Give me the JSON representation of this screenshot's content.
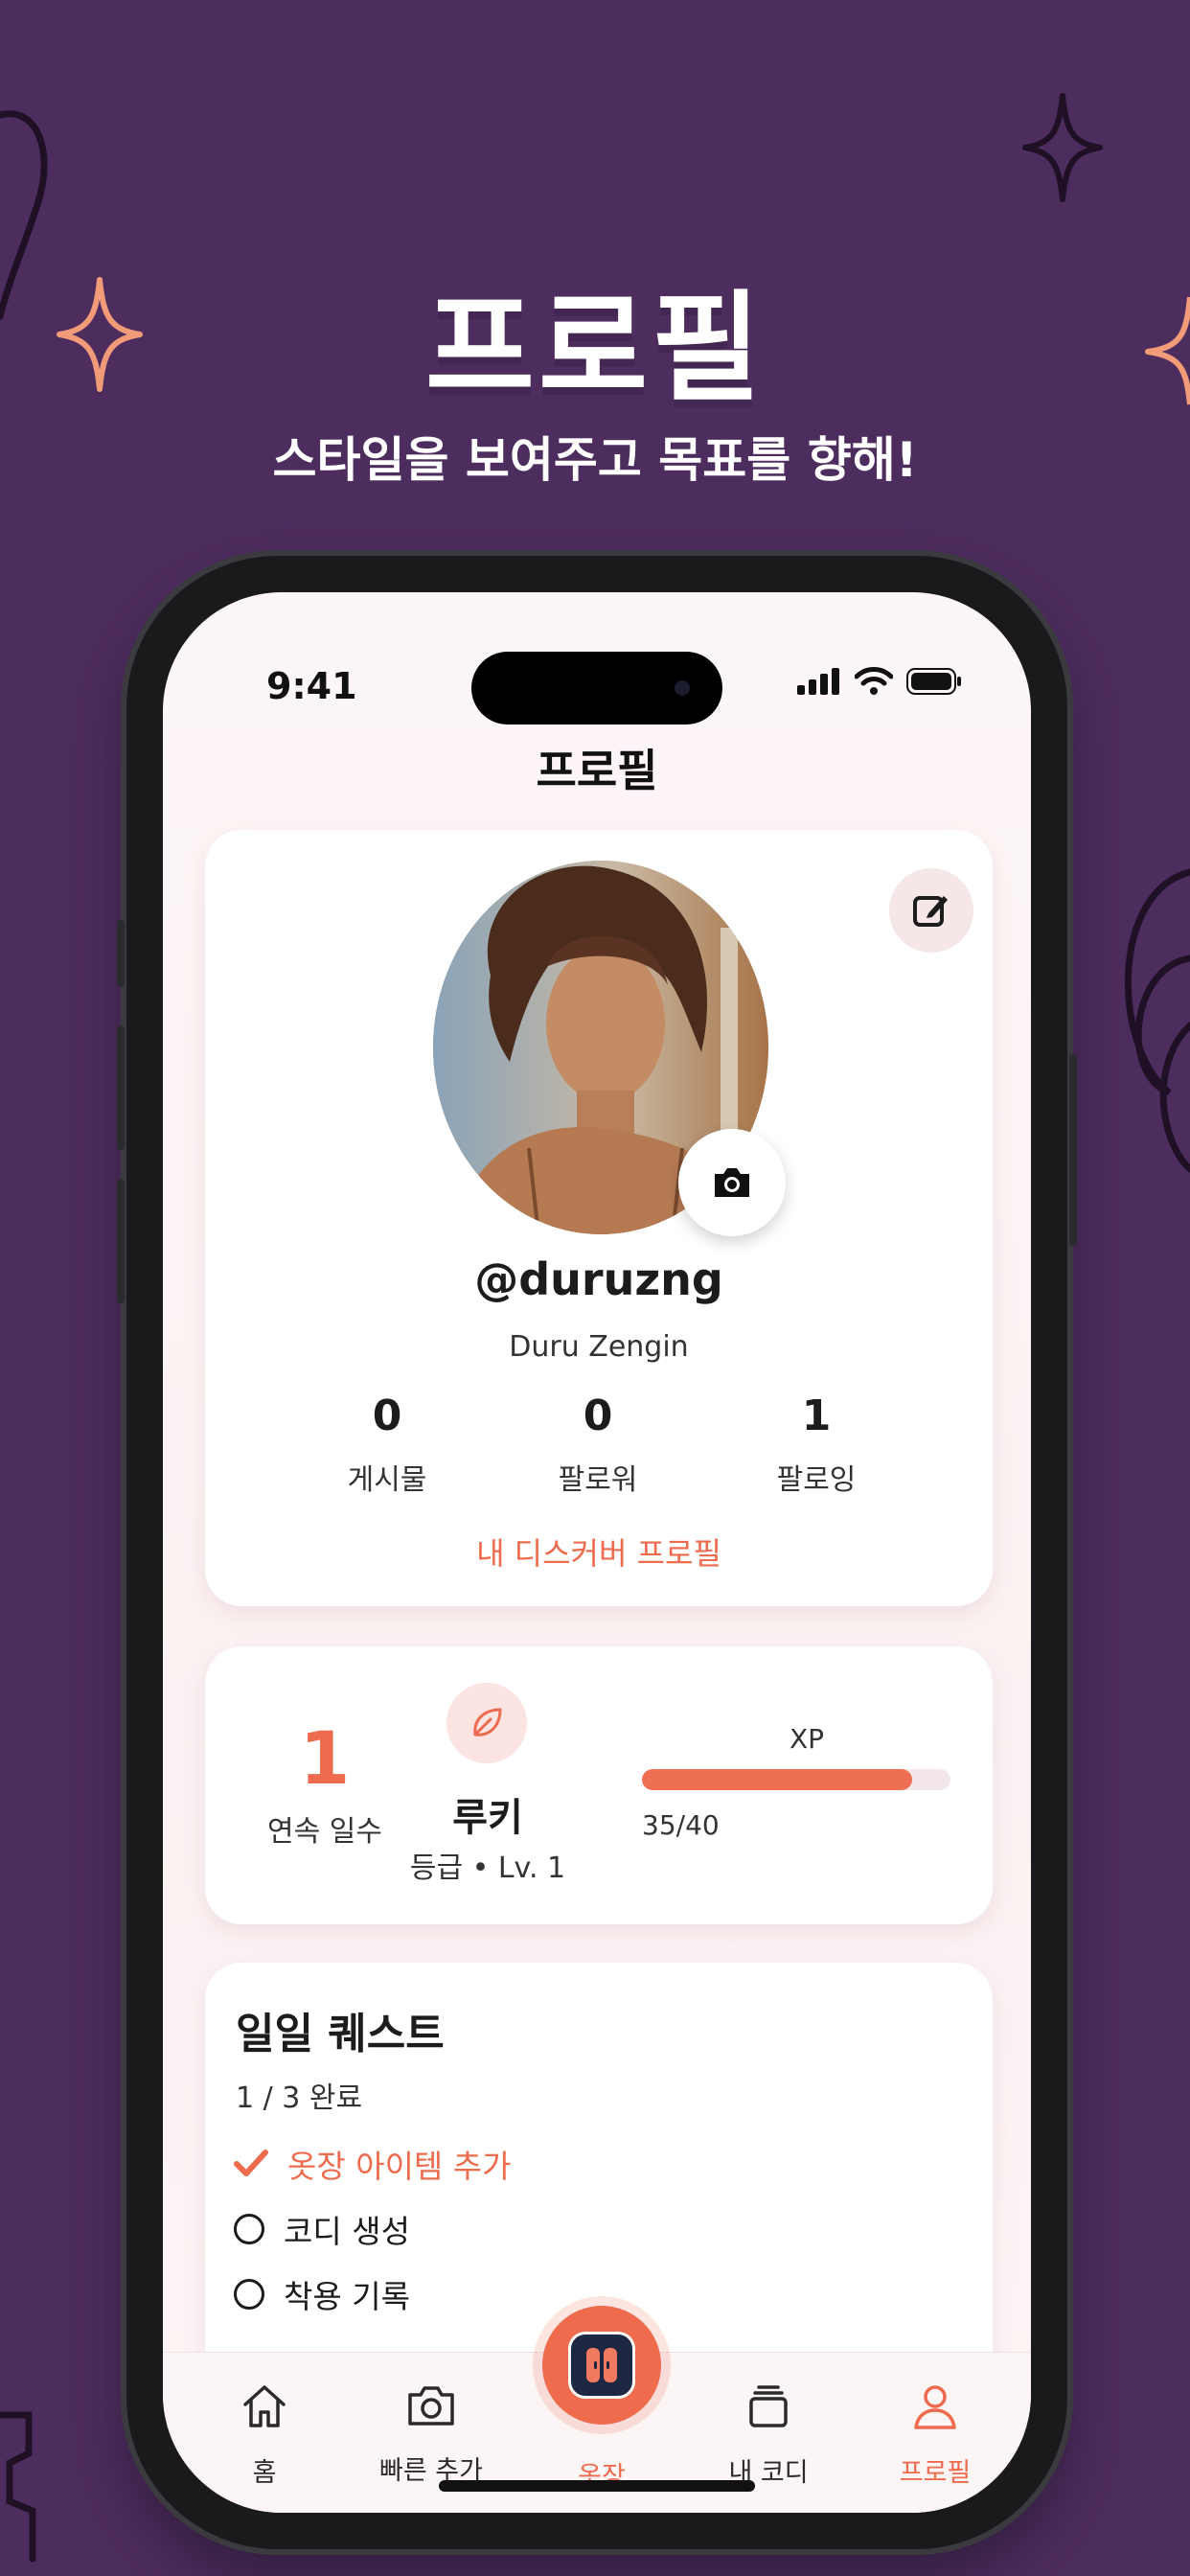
{
  "promo": {
    "title": "프로필",
    "subtitle": "스타일을 보여주고 목표를 향해!"
  },
  "status_bar": {
    "time": "9:41"
  },
  "header": {
    "title": "프로필"
  },
  "profile": {
    "username": "@duruzng",
    "display_name": "Duru Zengin",
    "stats": [
      {
        "value": "0",
        "label": "게시물"
      },
      {
        "value": "0",
        "label": "팔로워"
      },
      {
        "value": "1",
        "label": "팔로잉"
      }
    ],
    "discover_link": "내 디스커버 프로필",
    "edit_icon": "edit-icon",
    "camera_icon": "camera-icon"
  },
  "progress": {
    "streak_value": "1",
    "streak_label": "연속 일수",
    "rank_icon": "leaf-icon",
    "rank_name": "루키",
    "rank_level": "등급 • Lv. 1",
    "xp_label": "XP",
    "xp_text": "35/40",
    "xp_current": 35,
    "xp_max": 40
  },
  "quests": {
    "title": "일일 퀘스트",
    "progress": "1 / 3 완료",
    "items": [
      {
        "label": "옷장 아이템 추가",
        "done": true
      },
      {
        "label": "코디 생성",
        "done": false
      },
      {
        "label": "착용 기록",
        "done": false
      }
    ]
  },
  "tabbar": {
    "tabs": [
      {
        "label": "홈",
        "icon": "home-icon",
        "active": false
      },
      {
        "label": "빠른 추가",
        "icon": "camera-icon",
        "active": false
      },
      {
        "label": "옷장",
        "icon": "wardrobe-icon",
        "active": false
      },
      {
        "label": "내 코디",
        "icon": "outfits-icon",
        "active": false
      },
      {
        "label": "프로필",
        "icon": "person-icon",
        "active": true
      }
    ]
  },
  "colors": {
    "background": "#4d2c5e",
    "accent": "#ef6b4e",
    "sparkle_orange": "#f29b78"
  }
}
